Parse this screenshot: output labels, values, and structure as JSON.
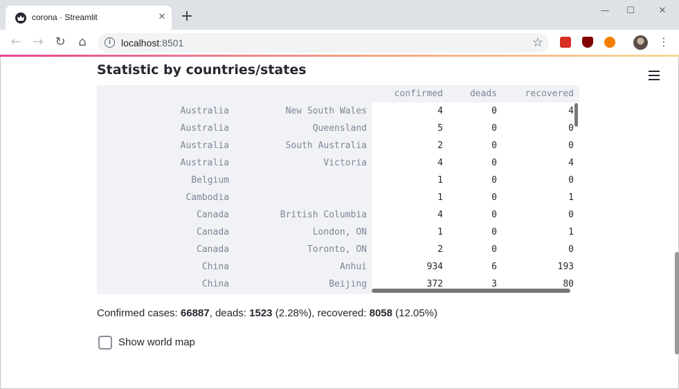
{
  "browser": {
    "tab_title": "corona · Streamlit",
    "tab_close": "✕",
    "new_tab": "+",
    "url_host": "localhost",
    "url_port": ":8501",
    "window_controls": {
      "minimize": "—",
      "maximize": "☐",
      "close": "✕"
    },
    "icons": [
      "back-icon",
      "forward-icon",
      "reload-icon",
      "home-icon",
      "info-icon",
      "star-icon",
      "menu-icon"
    ]
  },
  "app": {
    "heading": "Statistic by countries/states",
    "table": {
      "columns": [
        "confirmed",
        "deads",
        "recovered"
      ],
      "rows": [
        {
          "country": "Australia",
          "state": "New South Wales",
          "confirmed": "4",
          "deads": "0",
          "recovered": "4"
        },
        {
          "country": "Australia",
          "state": "Queensland",
          "confirmed": "5",
          "deads": "0",
          "recovered": "0"
        },
        {
          "country": "Australia",
          "state": "South Australia",
          "confirmed": "2",
          "deads": "0",
          "recovered": "0"
        },
        {
          "country": "Australia",
          "state": "Victoria",
          "confirmed": "4",
          "deads": "0",
          "recovered": "4"
        },
        {
          "country": "Belgium",
          "state": "",
          "confirmed": "1",
          "deads": "0",
          "recovered": "0"
        },
        {
          "country": "Cambodia",
          "state": "",
          "confirmed": "1",
          "deads": "0",
          "recovered": "1"
        },
        {
          "country": "Canada",
          "state": "British Columbia",
          "confirmed": "4",
          "deads": "0",
          "recovered": "0"
        },
        {
          "country": "Canada",
          "state": "London, ON",
          "confirmed": "1",
          "deads": "0",
          "recovered": "1"
        },
        {
          "country": "Canada",
          "state": "Toronto, ON",
          "confirmed": "2",
          "deads": "0",
          "recovered": "0"
        },
        {
          "country": "China",
          "state": "Anhui",
          "confirmed": "934",
          "deads": "6",
          "recovered": "193"
        },
        {
          "country": "China",
          "state": "Beijing",
          "confirmed": "372",
          "deads": "3",
          "recovered": "80"
        }
      ]
    },
    "summary": {
      "confirmed_label": "Confirmed cases: ",
      "confirmed": "66887",
      "deads_label": ", deads: ",
      "deads": "1523",
      "deads_pct": " (2.28%)",
      "recovered_label": ", recovered: ",
      "recovered": "8058",
      "recovered_pct": " (12.05%)"
    },
    "checkbox": {
      "label": "Show world map",
      "checked": false
    }
  }
}
